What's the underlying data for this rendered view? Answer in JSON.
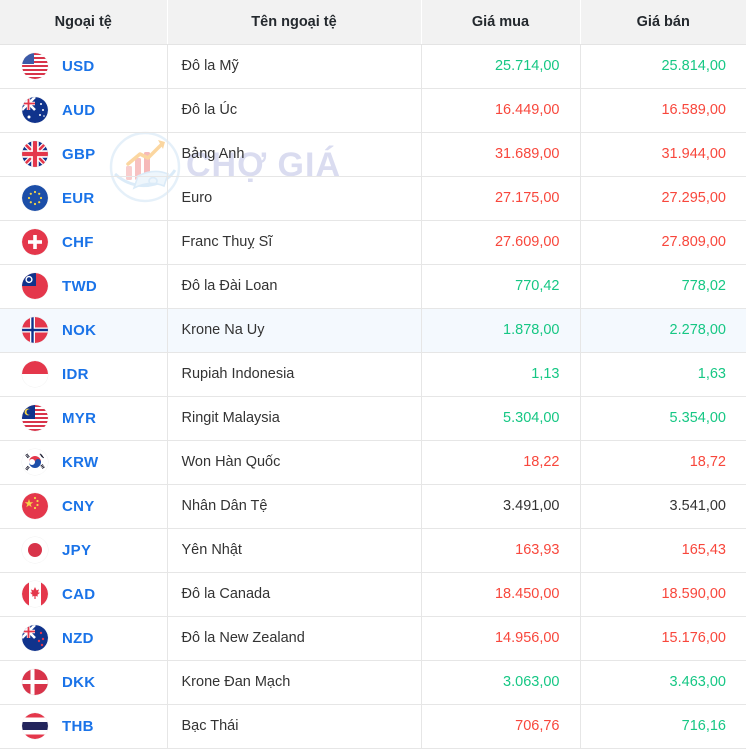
{
  "table": {
    "headers": {
      "code": "Ngoại tệ",
      "name": "Tên ngoại tệ",
      "buy": "Giá mua",
      "sell": "Giá bán"
    },
    "colors": {
      "up": "#16c784",
      "down": "#f8473c",
      "flat": "#333333",
      "code": "#1a73e8",
      "header_bg": "#f2f2f2",
      "row_highlight": "#f4f9fe",
      "border": "#e6e6e6"
    },
    "rows": [
      {
        "code": "USD",
        "flag": "flag-us-icon",
        "name": "Đô la Mỹ",
        "buy": "25.714,00",
        "sell": "25.814,00",
        "buy_trend": "up",
        "sell_trend": "up",
        "highlighted": false
      },
      {
        "code": "AUD",
        "flag": "flag-au-icon",
        "name": "Đô la Úc",
        "buy": "16.449,00",
        "sell": "16.589,00",
        "buy_trend": "down",
        "sell_trend": "down",
        "highlighted": false
      },
      {
        "code": "GBP",
        "flag": "flag-gb-icon",
        "name": "Bảng Anh",
        "buy": "31.689,00",
        "sell": "31.944,00",
        "buy_trend": "down",
        "sell_trend": "down",
        "highlighted": false
      },
      {
        "code": "EUR",
        "flag": "flag-eu-icon",
        "name": "Euro",
        "buy": "27.175,00",
        "sell": "27.295,00",
        "buy_trend": "down",
        "sell_trend": "down",
        "highlighted": false
      },
      {
        "code": "CHF",
        "flag": "flag-ch-icon",
        "name": "Franc Thuỵ Sĩ",
        "buy": "27.609,00",
        "sell": "27.809,00",
        "buy_trend": "down",
        "sell_trend": "down",
        "highlighted": false
      },
      {
        "code": "TWD",
        "flag": "flag-tw-icon",
        "name": "Đô la Đài Loan",
        "buy": "770,42",
        "sell": "778,02",
        "buy_trend": "up",
        "sell_trend": "up",
        "highlighted": false
      },
      {
        "code": "NOK",
        "flag": "flag-no-icon",
        "name": "Krone Na Uy",
        "buy": "1.878,00",
        "sell": "2.278,00",
        "buy_trend": "up",
        "sell_trend": "up",
        "highlighted": true
      },
      {
        "code": "IDR",
        "flag": "flag-id-icon",
        "name": "Rupiah Indonesia",
        "buy": "1,13",
        "sell": "1,63",
        "buy_trend": "up",
        "sell_trend": "up",
        "highlighted": false
      },
      {
        "code": "MYR",
        "flag": "flag-my-icon",
        "name": "Ringit Malaysia",
        "buy": "5.304,00",
        "sell": "5.354,00",
        "buy_trend": "up",
        "sell_trend": "up",
        "highlighted": false
      },
      {
        "code": "KRW",
        "flag": "flag-kr-icon",
        "name": "Won Hàn Quốc",
        "buy": "18,22",
        "sell": "18,72",
        "buy_trend": "down",
        "sell_trend": "down",
        "highlighted": false
      },
      {
        "code": "CNY",
        "flag": "flag-cn-icon",
        "name": "Nhân Dân Tệ",
        "buy": "3.491,00",
        "sell": "3.541,00",
        "buy_trend": "flat",
        "sell_trend": "flat",
        "highlighted": false
      },
      {
        "code": "JPY",
        "flag": "flag-jp-icon",
        "name": "Yên Nhật",
        "buy": "163,93",
        "sell": "165,43",
        "buy_trend": "down",
        "sell_trend": "down",
        "highlighted": false
      },
      {
        "code": "CAD",
        "flag": "flag-ca-icon",
        "name": "Đô la Canada",
        "buy": "18.450,00",
        "sell": "18.590,00",
        "buy_trend": "down",
        "sell_trend": "down",
        "highlighted": false
      },
      {
        "code": "NZD",
        "flag": "flag-nz-icon",
        "name": "Đô la New Zealand",
        "buy": "14.956,00",
        "sell": "15.176,00",
        "buy_trend": "down",
        "sell_trend": "down",
        "highlighted": false
      },
      {
        "code": "DKK",
        "flag": "flag-dk-icon",
        "name": "Krone Đan Mạch",
        "buy": "3.063,00",
        "sell": "3.463,00",
        "buy_trend": "up",
        "sell_trend": "up",
        "highlighted": false
      },
      {
        "code": "THB",
        "flag": "flag-th-icon",
        "name": "Bạc Thái",
        "buy": "706,76",
        "sell": "716,16",
        "buy_trend": "down",
        "sell_trend": "up",
        "highlighted": false
      }
    ]
  },
  "watermark": {
    "text": "CHỢ GIÁ",
    "logo_icon": "chart-money-logo-icon",
    "color": "#b9bde4"
  }
}
